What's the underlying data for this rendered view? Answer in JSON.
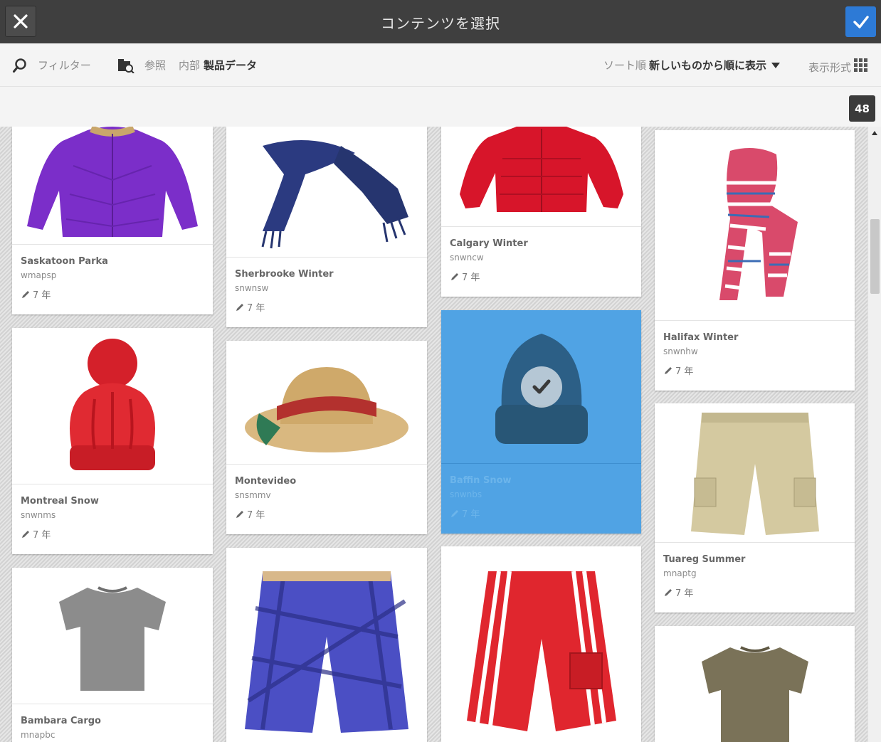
{
  "header": {
    "title": "コンテンツを選択",
    "close_icon": "close-icon",
    "confirm_icon": "check-icon"
  },
  "toolbar": {
    "filter_label": "フィルター",
    "browse_label": "参照",
    "location_prefix": "内部",
    "location_value": "製品データ",
    "sort_prefix": "ソート順",
    "sort_value": "新しいものから順に表示",
    "view_label": "表示形式",
    "count": "48"
  },
  "colors": {
    "titlebar": "#3f3f3f",
    "confirm": "#2d7ad6",
    "selected": "#50a3e4"
  },
  "cards": [
    {
      "name": "Saskatoon Parka",
      "sku": "wmapsp",
      "age": "7 年",
      "image": "purple-parka",
      "selected": false
    },
    {
      "name": "Sherbrooke Winter",
      "sku": "snwnsw",
      "age": "7 年",
      "image": "navy-scarf",
      "selected": false
    },
    {
      "name": "Calgary Winter",
      "sku": "snwncw",
      "age": "7 年",
      "image": "red-jacket",
      "selected": false
    },
    {
      "name": "Halifax Winter",
      "sku": "snwnhw",
      "age": "7 年",
      "image": "striped-scarf",
      "selected": false
    },
    {
      "name": "Montreal Snow",
      "sku": "snwnms",
      "age": "7 年",
      "image": "red-beanie",
      "selected": false
    },
    {
      "name": "Montevideo",
      "sku": "snsmmv",
      "age": "7 年",
      "image": "straw-hat",
      "selected": false
    },
    {
      "name": "Baffin Snow",
      "sku": "snwnbs",
      "age": "7 年",
      "image": "blue-beanie",
      "selected": true
    },
    {
      "name": "Tuareg Summer",
      "sku": "mnaptg",
      "age": "7 年",
      "image": "khaki-shorts",
      "selected": false
    },
    {
      "name": "Bambara Cargo",
      "sku": "mnapbc",
      "age": "",
      "image": "gray-tshirt",
      "selected": false
    },
    {
      "name": "",
      "sku": "",
      "age": "",
      "image": "plaid-shorts",
      "selected": false
    },
    {
      "name": "",
      "sku": "",
      "age": "",
      "image": "red-board-shorts",
      "selected": false
    },
    {
      "name": "",
      "sku": "",
      "age": "",
      "image": "olive-tshirt",
      "selected": false
    }
  ]
}
